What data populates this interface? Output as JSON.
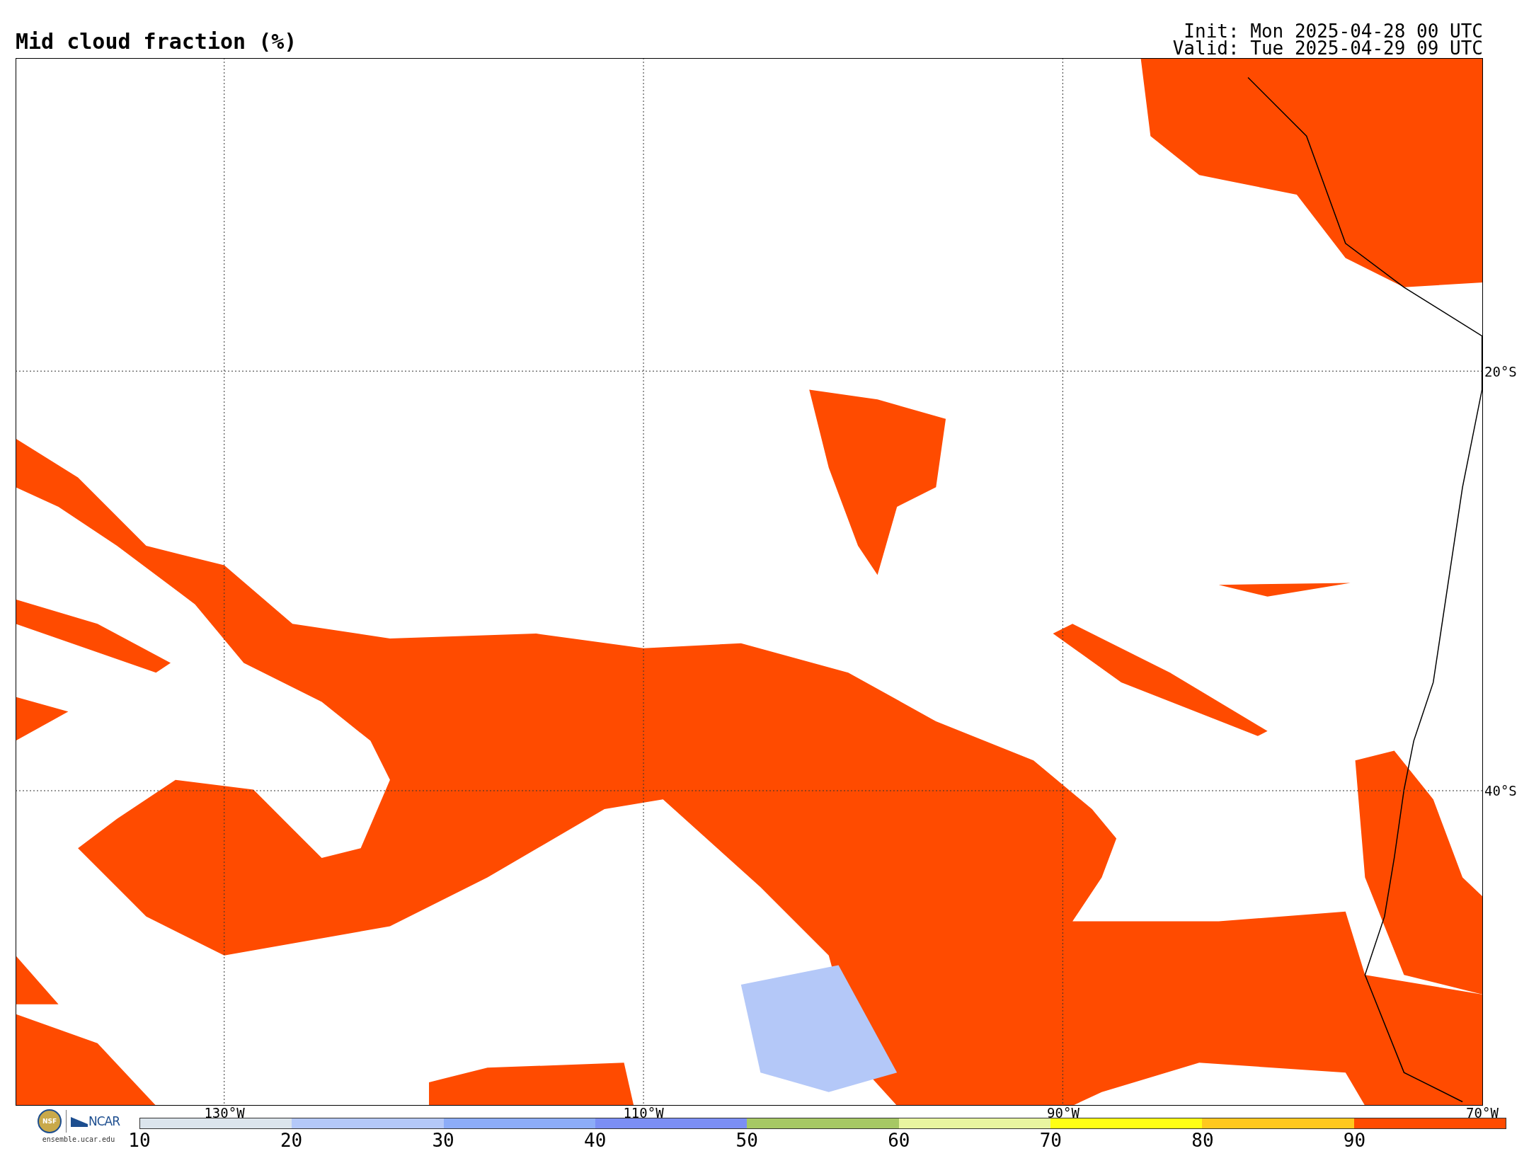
{
  "title": "Mid cloud fraction (%)",
  "run_info": [
    "Init: Mon 2025-04-28 00 UTC",
    "Valid: Tue 2025-04-29 09 UTC"
  ],
  "map": {
    "lat_labels": [
      "20°S",
      "40°S"
    ],
    "lon_labels": [
      "130°W",
      "110°W",
      "90°W",
      "70°W"
    ]
  },
  "logos": {
    "seal": "NSF",
    "lab": "NCAR",
    "url": "ensemble.ucar.edu"
  },
  "colorbar": {
    "segments": [
      {
        "color": "#dbe4ec"
      },
      {
        "color": "#b4c8f8"
      },
      {
        "color": "#8cacf8"
      },
      {
        "color": "#7b8ef4"
      },
      {
        "color": "#a6c864"
      },
      {
        "color": "#e8f5a0"
      },
      {
        "color": "#ffff14"
      },
      {
        "color": "#ffc81e"
      },
      {
        "color": "#ff4b00"
      }
    ],
    "ticks": [
      "10",
      "20",
      "30",
      "40",
      "50",
      "60",
      "70",
      "80",
      "90"
    ]
  }
}
